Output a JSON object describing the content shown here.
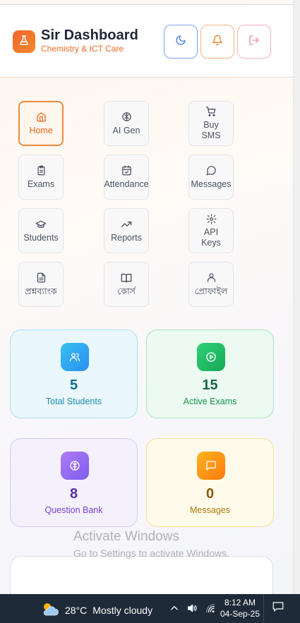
{
  "header": {
    "title": "Sir Dashboard",
    "subtitle": "Chemistry & ICT Care",
    "logo_icon": "flask-icon",
    "buttons": [
      {
        "icon": "moon-icon",
        "color": "#4a7bea"
      },
      {
        "icon": "bell-icon",
        "color": "#ec7f1e"
      },
      {
        "icon": "logout-icon",
        "color": "#ee8a9a"
      }
    ]
  },
  "nav": {
    "items": [
      {
        "label": "Home",
        "icon": "home-icon",
        "active": true
      },
      {
        "label": "AI Gen",
        "icon": "brain-icon",
        "active": false
      },
      {
        "label": "Buy SMS",
        "icon": "cart-icon",
        "active": false
      },
      {
        "label": "Exams",
        "icon": "clipboard-icon",
        "active": false
      },
      {
        "label": "Attendance",
        "icon": "calendar-check-icon",
        "active": false
      },
      {
        "label": "Messages",
        "icon": "chat-icon",
        "active": false
      },
      {
        "label": "Students",
        "icon": "graduation-cap-icon",
        "active": false
      },
      {
        "label": "Reports",
        "icon": "trending-up-icon",
        "active": false
      },
      {
        "label": "API Keys",
        "icon": "settings-icon",
        "active": false
      },
      {
        "label": "প্রশ্নব্যাংক",
        "icon": "document-icon",
        "active": false
      },
      {
        "label": "কোর্স",
        "icon": "book-icon",
        "active": false
      },
      {
        "label": "প্রোফাইল",
        "icon": "user-icon",
        "active": false
      }
    ]
  },
  "stats": [
    {
      "value": "5",
      "label": "Total Students",
      "icon": "users-icon"
    },
    {
      "value": "15",
      "label": "Active Exams",
      "icon": "play-circle-icon"
    },
    {
      "value": "8",
      "label": "Question Bank",
      "icon": "brain-icon"
    },
    {
      "value": "0",
      "label": "Messages",
      "icon": "message-square-icon"
    }
  ],
  "watermark": {
    "line1": "Activate Windows",
    "line2": "Go to Settings to activate Windows."
  },
  "taskbar": {
    "temperature": "28°C",
    "condition": "Mostly cloudy",
    "time": "8:12 AM",
    "date": "04-Sep-25"
  },
  "colors": {
    "accent": "#f06a22",
    "active_border": "#ef8a3c"
  }
}
